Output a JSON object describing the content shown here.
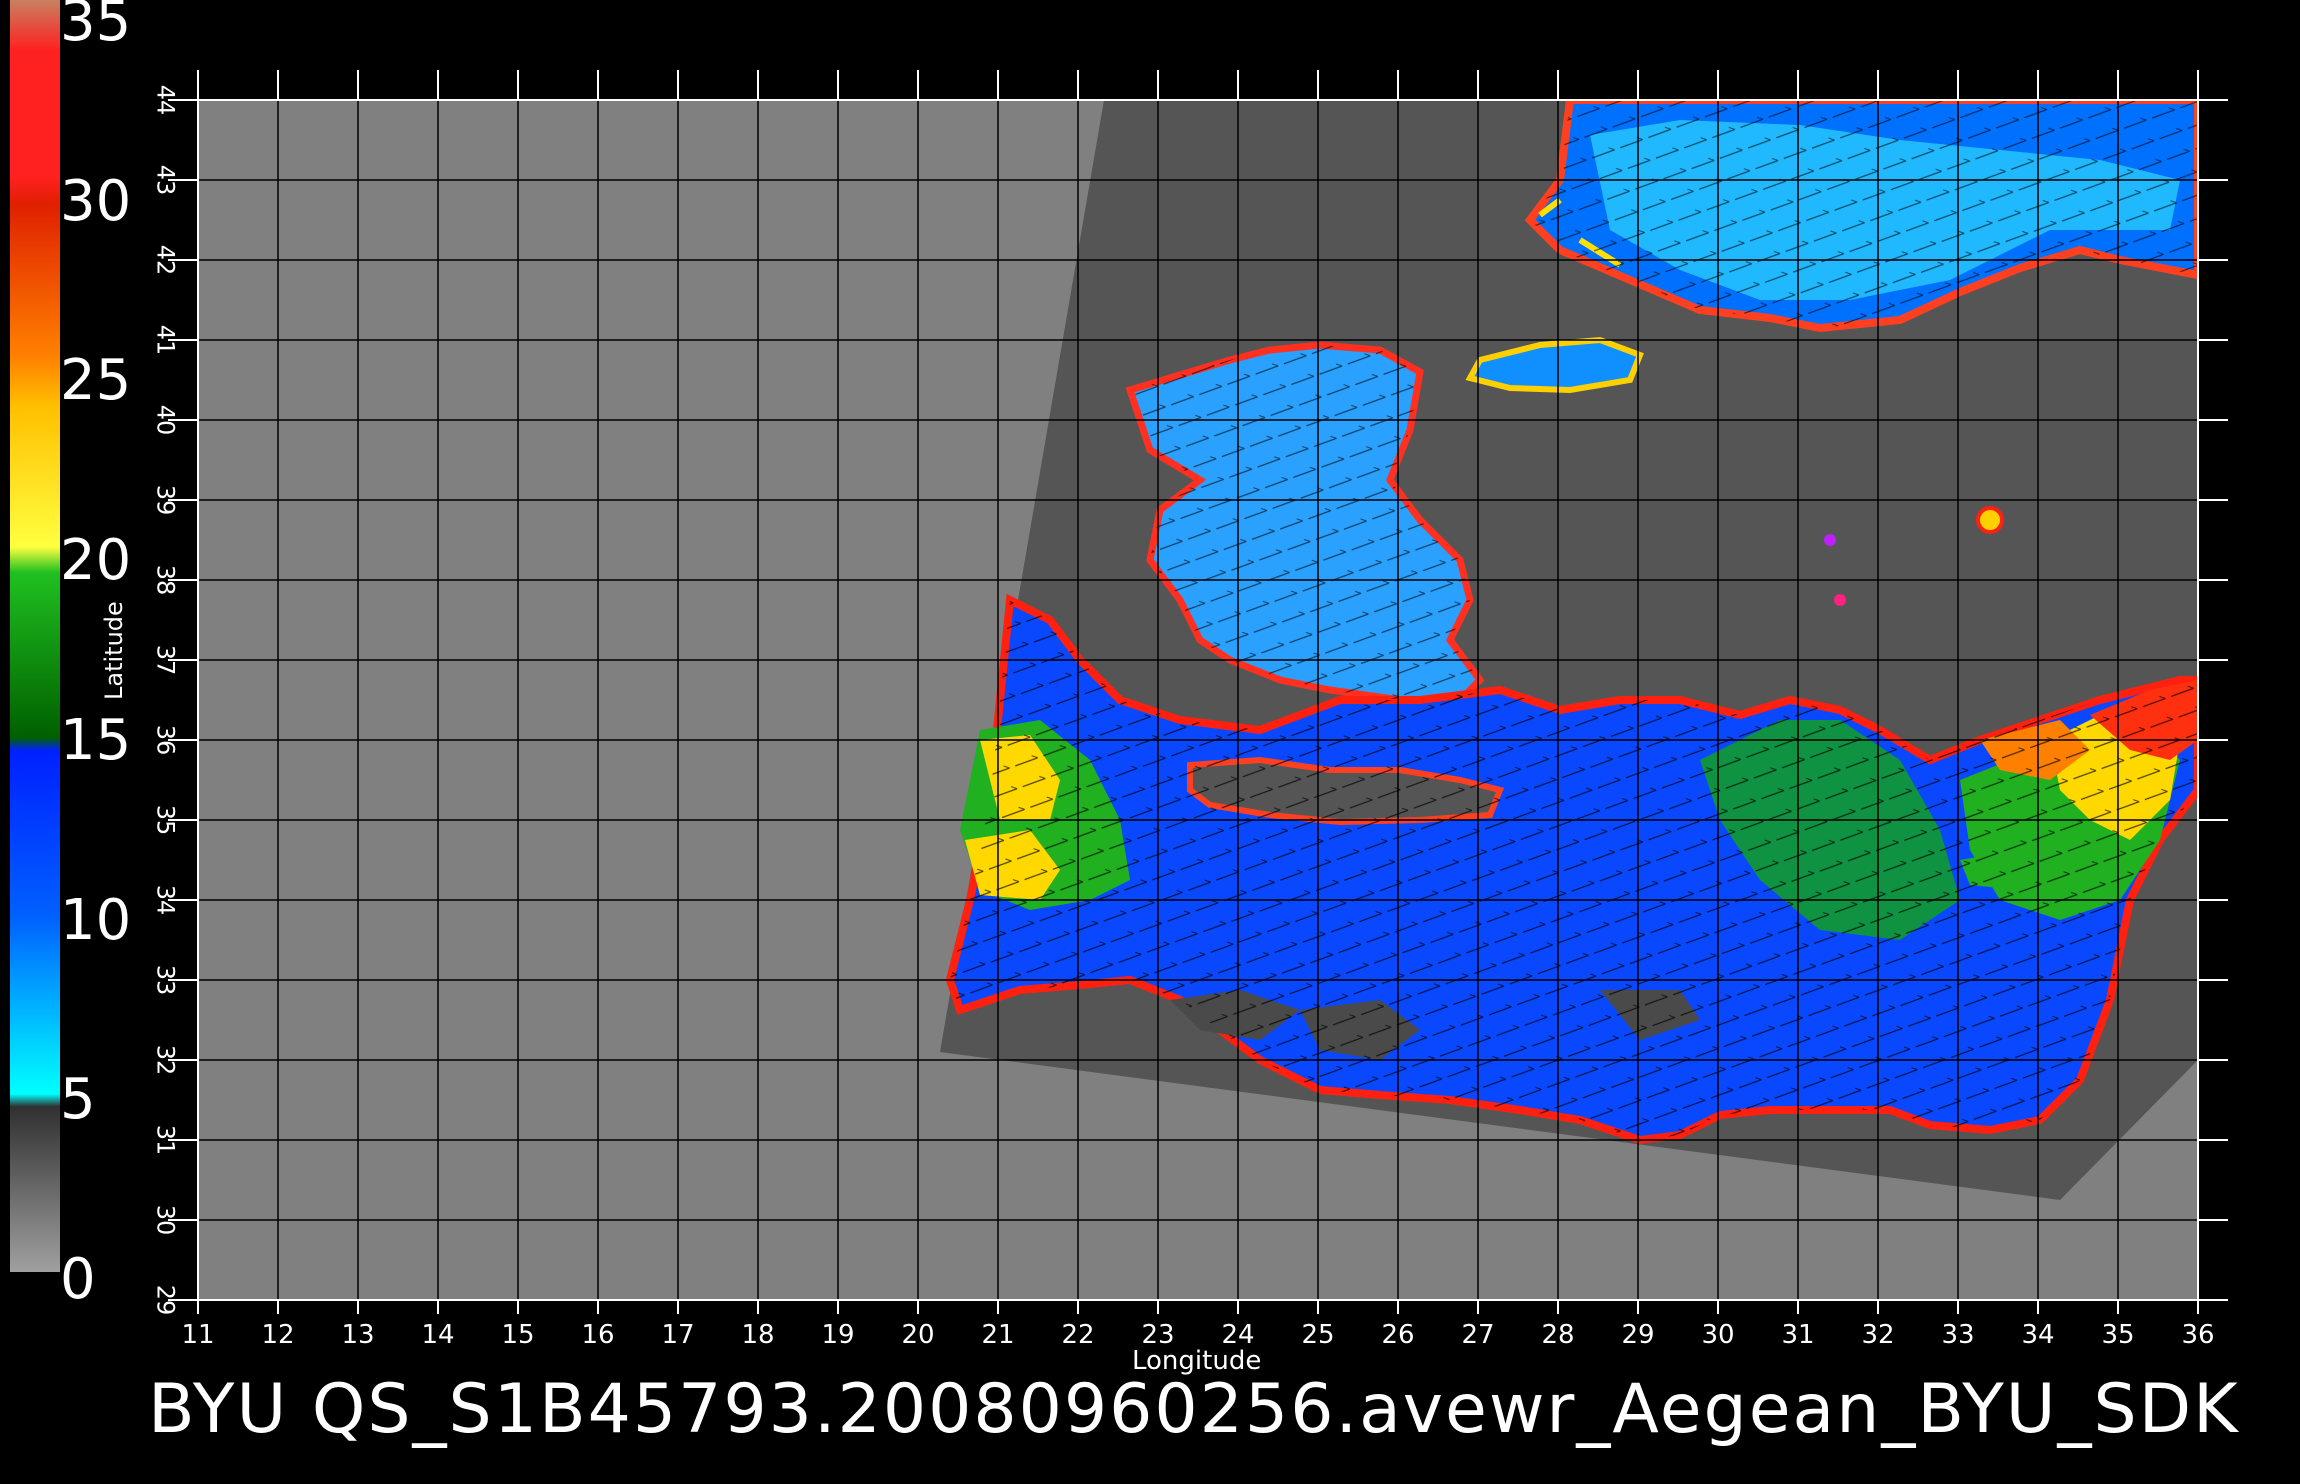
{
  "colorbar": {
    "labels": [
      "35",
      "30",
      "25",
      "20",
      "15",
      "10",
      "5",
      "0"
    ]
  },
  "axes": {
    "xlabel": "Longitude",
    "ylabel": "Latitude",
    "x_ticks": [
      "11",
      "12",
      "13",
      "14",
      "15",
      "16",
      "17",
      "18",
      "19",
      "20",
      "21",
      "22",
      "23",
      "24",
      "25",
      "26",
      "27",
      "28",
      "29",
      "30",
      "31",
      "32",
      "33",
      "34",
      "35",
      "36"
    ],
    "y_ticks": [
      "29",
      "30",
      "31",
      "32",
      "33",
      "34",
      "35",
      "36",
      "37",
      "38",
      "39",
      "40",
      "41",
      "42",
      "43",
      "44"
    ]
  },
  "footer": {
    "title": "BYU  QS_S1B45793.20080960256.avewr_Aegean_BYU_SDK"
  },
  "colors": {
    "land": "#808080",
    "swath_bg": "#555555",
    "low": "#00e0ff",
    "mid": "#0040ff",
    "green": "#00b000",
    "yellow": "#ffe000",
    "orange": "#ff8000",
    "red": "#ff1010"
  }
}
